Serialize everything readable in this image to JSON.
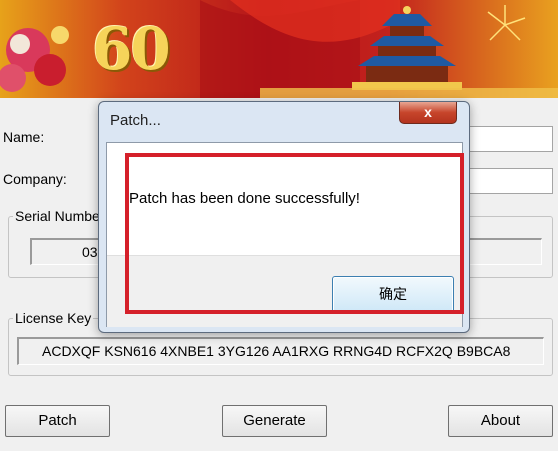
{
  "banner": {
    "number": "60"
  },
  "form": {
    "name_label": "Name:",
    "name_value": "",
    "company_label": "Company:",
    "company_value": "",
    "serial_group_label": "Serial Numbe",
    "serial_value_partial": "03",
    "license_group_label": "License Key",
    "license_value": "ACDXQF KSN616 4XNBE1 3YG126 AA1RXG RRNG4D RCFX2Q B9BCA8"
  },
  "buttons": {
    "patch": "Patch",
    "generate": "Generate",
    "about": "About"
  },
  "dialog": {
    "title": "Patch...",
    "close_symbol": "x",
    "message": "Patch has been done successfully!",
    "ok_label": "确定"
  },
  "colors": {
    "highlight": "#d5202a",
    "banner_red": "#b5141a",
    "banner_gold": "#e7a21a"
  }
}
